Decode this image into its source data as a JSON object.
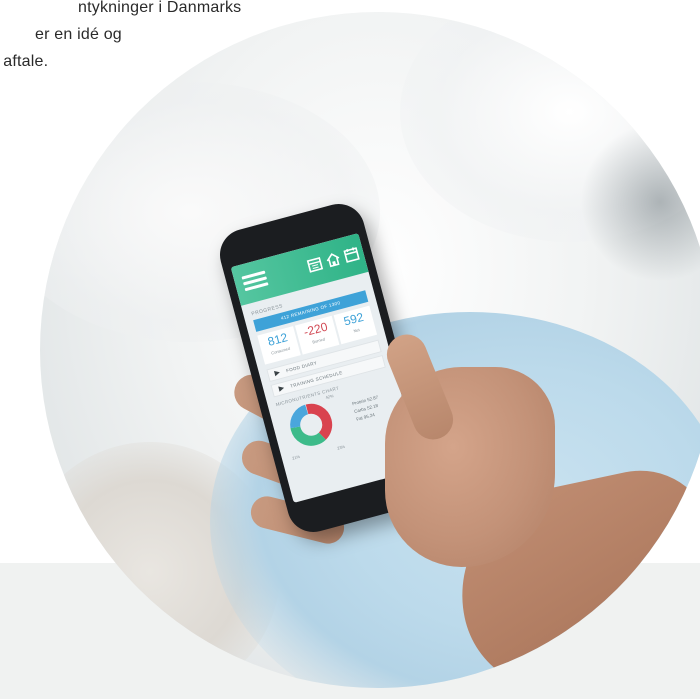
{
  "intro": {
    "line1": "ntykninger i Danmarks",
    "line2": "er en idé og",
    "line3": "t aftale."
  },
  "phone_app": {
    "header_icons": [
      "menu-icon",
      "calendar-icon",
      "home-icon",
      "calendar-icon"
    ],
    "progress_label": "PROGRESS",
    "remaining_label": "412 REMAINING OF 1300",
    "stats": [
      {
        "value": "812",
        "caption": "Consumed"
      },
      {
        "value": "-220",
        "caption": "Burned"
      },
      {
        "value": "592",
        "caption": "Net"
      }
    ],
    "menu_items": [
      "FOOD DIARY",
      "TRAINING SCHEDULE"
    ],
    "chart_title": "MICRONUTRIENTS CHART",
    "chart_percents": [
      "42%",
      "21%",
      "23%"
    ],
    "legend": [
      "Protein 52.87",
      "Carbs 52.18",
      "Fat 95.24"
    ],
    "colors": {
      "header": "#2fb387",
      "accent_blue": "#3ea2d8",
      "negative_red": "#d24a55",
      "donut_red": "#d9434f",
      "donut_green": "#3dbb8a",
      "donut_blue": "#4aa6dc"
    }
  }
}
